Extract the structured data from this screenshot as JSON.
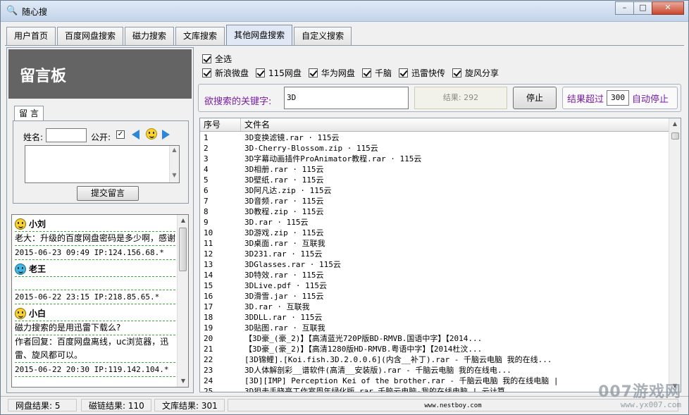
{
  "window": {
    "title": "随心搜",
    "min": "–",
    "max": "□",
    "close": "✕"
  },
  "tabs": [
    {
      "label": "用户首页"
    },
    {
      "label": "百度网盘搜索"
    },
    {
      "label": "磁力搜索"
    },
    {
      "label": "文库搜索"
    },
    {
      "label": "其他网盘搜索"
    },
    {
      "label": "自定义搜索"
    }
  ],
  "guestbook": {
    "title": "留言板",
    "tab": "留 言",
    "name_label": "姓名:",
    "name_value": "",
    "public_label": "公开:",
    "public_checked": "✓",
    "submit": "提交留言",
    "messages": [
      {
        "name": "小刘",
        "lines": [
          "老大：升级的百度网盘密码是多少啊，感谢"
        ],
        "meta": "2015-06-23 09:49 IP:124.156.68.*"
      },
      {
        "name": "老王",
        "lines": [
          ""
        ],
        "meta": "2015-06-22 23:15 IP:218.85.65.*"
      },
      {
        "name": "小白",
        "lines": [
          "磁力搜索的是用迅雷下载么?",
          "作者回复：百度网盘离线，uc浏览器，迅雷、旋风都可以。"
        ],
        "meta": "2015-06-22 20:30 IP:119.142.104.*"
      }
    ]
  },
  "search": {
    "select_all": "全选",
    "sources": [
      "新浪微盘",
      "115网盘",
      "华为网盘",
      "千脑",
      "迅雷快传",
      "旋风分享"
    ],
    "keyword_label": "欲搜索的关键字:",
    "keyword_value": "3D",
    "result_display": "结果: 292",
    "stop_button": "停止",
    "autostop_prefix": "结果超过",
    "autostop_value": "300",
    "autostop_suffix": "自动停止"
  },
  "results": {
    "col_no": "序号",
    "col_name": "文件名",
    "rows": [
      [
        "1",
        "3D变换滤镜.rar · 115云"
      ],
      [
        "2",
        "3D-Cherry-Blossom.zip · 115云"
      ],
      [
        "3",
        "3D字幕动画插件ProAnimator教程.rar · 115云"
      ],
      [
        "4",
        "3D相册.rar · 115云"
      ],
      [
        "5",
        "3D壁纸.rar · 115云"
      ],
      [
        "6",
        "3D阿凡达.zip · 115云"
      ],
      [
        "7",
        "3D音频.rar · 115云"
      ],
      [
        "8",
        "3D教程.zip · 115云"
      ],
      [
        "9",
        "3D.rar · 115云"
      ],
      [
        "10",
        "3D游戏.zip · 115云"
      ],
      [
        "11",
        "3D桌面.rar · 互联我"
      ],
      [
        "12",
        "3D231.rar · 115云"
      ],
      [
        "13",
        "3DGlasses.rar · 115云"
      ],
      [
        "14",
        "3D特效.rar · 115云"
      ],
      [
        "15",
        "3DLive.pdf · 115云"
      ],
      [
        "16",
        "3D滑雪.jar · 115云"
      ],
      [
        "17",
        "3D.rar · 互联我"
      ],
      [
        "18",
        "3DDLL.rar · 115云"
      ],
      [
        "19",
        "3D贴图.rar · 互联我"
      ],
      [
        "20",
        "【3D豪_(豪_2)】【高清蓝光720P版BD-RMVB.国语中字】【2014..."
      ],
      [
        "21",
        "【3D豪_(豪_2)】【高清1280版HD-RMVB.粤语中字】【2014杜汶..."
      ],
      [
        "22",
        "[3D锦鲤].[Koi.fish.3D.2.0.0.6](内含__补丁).rar - 千脑云电脑 我的在线..."
      ],
      [
        "23",
        "3D人体解剖彩__谱软件(高清__安装版).rar - 千脑云电脑 我的在线电..."
      ],
      [
        "24",
        "[3D][IMP] Perception Kei of the brother.rar - 千脑云电脑 我的在线电脑 |"
      ],
      [
        "25",
        "3D狙击手晓亮工作室周年绿化版.rar 千脑云电脑-我的在线电脑 | 云计算 ..."
      ]
    ]
  },
  "status": {
    "netdisk": "网盘结果: 5",
    "magnet": "磁链结果: 110",
    "wenku": "文库结果: 301",
    "url": "www.nestboy.com"
  },
  "watermark": {
    "brand": "007游戏网",
    "url": "www.yx007.com"
  }
}
